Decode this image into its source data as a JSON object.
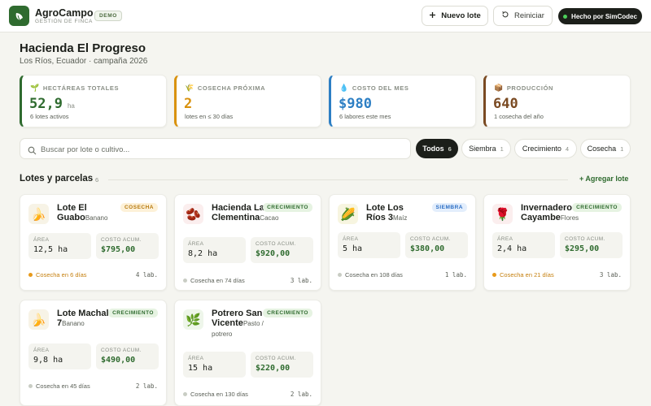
{
  "app": {
    "name": "AgroCampo",
    "subtitle": "GESTIÓN DE FINCA",
    "badge": "DEMO",
    "logo_icon": "leaf-icon",
    "accent": "#2f6b2f"
  },
  "toolbar": {
    "new_lot_label": "Nuevo lote",
    "reset_label": "Reiniciar",
    "made_by_label": "Hecho por SimCodec"
  },
  "page": {
    "title": "Hacienda El Progreso",
    "subtitle": "Los Ríos, Ecuador · campaña 2026"
  },
  "stats": [
    {
      "icon": "seedling-icon",
      "label": "HECTÁREAS TOTALES",
      "value": "52,9",
      "unit": "ha",
      "foot": "6 lotes activos",
      "color": "#2f6b2f"
    },
    {
      "icon": "wheat-icon",
      "label": "COSECHA PRÓXIMA",
      "value": "2",
      "unit": "",
      "foot": "lotes en ≤ 30 días",
      "color": "#d9920e"
    },
    {
      "icon": "droplet-icon",
      "label": "COSTO DEL MES",
      "value": "$980",
      "unit": "",
      "foot": "6 labores este mes",
      "color": "#2d7fc4"
    },
    {
      "icon": "box-icon",
      "label": "PRODUCCIÓN",
      "value": "640",
      "unit": "",
      "foot": "1 cosecha del año",
      "color": "#7a4a22"
    }
  ],
  "search": {
    "placeholder": "Buscar por lote o cultivo..."
  },
  "filters": [
    {
      "label": "Todos",
      "count": "6"
    },
    {
      "label": "Siembra",
      "count": "1"
    },
    {
      "label": "Crecimiento",
      "count": "4"
    },
    {
      "label": "Cosecha",
      "count": "1"
    }
  ],
  "section": {
    "title": "Lotes y parcelas",
    "count": "6",
    "add_label": "+ Agregar lote"
  },
  "lots": [
    {
      "icon": "banana-icon",
      "emoji": "🍌",
      "name": "Lote El Guabo",
      "crop": "Banano",
      "status": "COSECHA",
      "status_class": "cosecha",
      "area_label": "ÁREA",
      "area": "12,5 ha",
      "cost_label": "COSTO ACUM.",
      "cost": "$795,00",
      "harvest": "Cosecha en 6 días",
      "hot": true,
      "labs": "4 lab."
    },
    {
      "icon": "cacao-icon",
      "emoji": "🫘",
      "name": "Hacienda La Clementina",
      "crop": "Cacao",
      "status": "CRECIMIENTO",
      "status_class": "crecimiento",
      "area_label": "ÁREA",
      "area": "8,2 ha",
      "cost_label": "COSTO ACUM.",
      "cost": "$920,00",
      "harvest": "Cosecha en 74 días",
      "hot": false,
      "labs": "3 lab."
    },
    {
      "icon": "corn-icon",
      "emoji": "🌽",
      "name": "Lote Los Ríos 3",
      "crop": "Maíz",
      "status": "SIEMBRA",
      "status_class": "siembra",
      "area_label": "ÁREA",
      "area": "5 ha",
      "cost_label": "COSTO ACUM.",
      "cost": "$380,00",
      "harvest": "Cosecha en 108 días",
      "hot": false,
      "labs": "1 lab."
    },
    {
      "icon": "rose-icon",
      "emoji": "🌹",
      "name": "Invernadero Cayambe",
      "crop": "Flores",
      "status": "CRECIMIENTO",
      "status_class": "crecimiento",
      "area_label": "ÁREA",
      "area": "2,4 ha",
      "cost_label": "COSTO ACUM.",
      "cost": "$295,00",
      "harvest": "Cosecha en 21 días",
      "hot": true,
      "labs": "3 lab."
    },
    {
      "icon": "banana-icon",
      "emoji": "🍌",
      "name": "Lote Machala 7",
      "crop": "Banano",
      "status": "CRECIMIENTO",
      "status_class": "crecimiento",
      "area_label": "ÁREA",
      "area": "9,8 ha",
      "cost_label": "COSTO ACUM.",
      "cost": "$490,00",
      "harvest": "Cosecha en 45 días",
      "hot": false,
      "labs": "2 lab."
    },
    {
      "icon": "herb-icon",
      "emoji": "🌿",
      "name": "Potrero San Vicente",
      "crop": "Pasto / potrero",
      "status": "CRECIMIENTO",
      "status_class": "crecimiento",
      "area_label": "ÁREA",
      "area": "15 ha",
      "cost_label": "COSTO ACUM.",
      "cost": "$220,00",
      "harvest": "Cosecha en 130 días",
      "hot": false,
      "labs": "2 lab."
    }
  ]
}
